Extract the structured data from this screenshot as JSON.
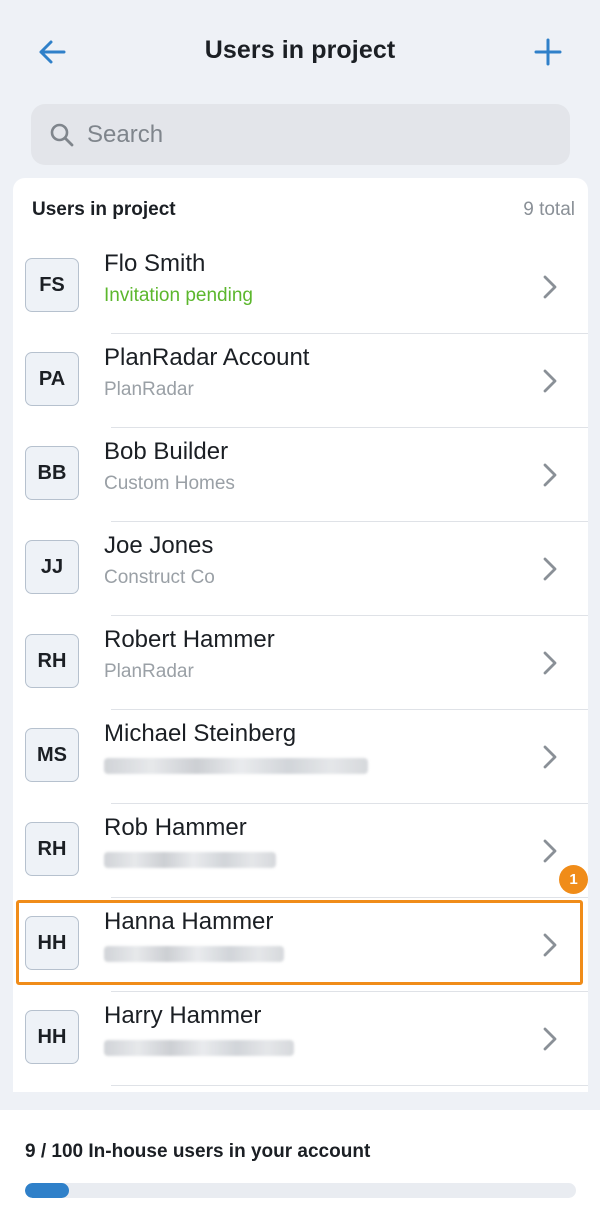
{
  "header": {
    "title": "Users in project",
    "back_icon": "arrow-left-icon",
    "add_icon": "plus-icon",
    "accent_color": "#2f80c9"
  },
  "search": {
    "placeholder": "Search",
    "icon": "search-icon"
  },
  "list": {
    "title": "Users in project",
    "count": "9 total",
    "users": [
      {
        "initials": "FS",
        "name": "Flo Smith",
        "subtitle": "Invitation pending",
        "status": "pending"
      },
      {
        "initials": "PA",
        "name": "PlanRadar Account",
        "subtitle": "PlanRadar"
      },
      {
        "initials": "BB",
        "name": "Bob Builder",
        "subtitle": "Custom Homes"
      },
      {
        "initials": "JJ",
        "name": "Joe Jones",
        "subtitle": "Construct Co"
      },
      {
        "initials": "RH",
        "name": "Robert Hammer",
        "subtitle": "PlanRadar"
      },
      {
        "initials": "MS",
        "name": "Michael Steinberg",
        "subtitle": "",
        "subtitle_redacted": true
      },
      {
        "initials": "RH",
        "name": "Rob Hammer",
        "subtitle": "",
        "subtitle_redacted": true
      },
      {
        "initials": "HH",
        "name": "Hanna Hammer",
        "subtitle": "",
        "subtitle_redacted": true,
        "highlighted": true
      },
      {
        "initials": "HH",
        "name": "Harry Hammer",
        "subtitle": "",
        "subtitle_redacted": true
      }
    ]
  },
  "annotation": {
    "badge_label": "1",
    "color": "#f08c19"
  },
  "footer": {
    "text": "9 / 100 In-house users in your account",
    "progress_fraction": 0.08
  }
}
